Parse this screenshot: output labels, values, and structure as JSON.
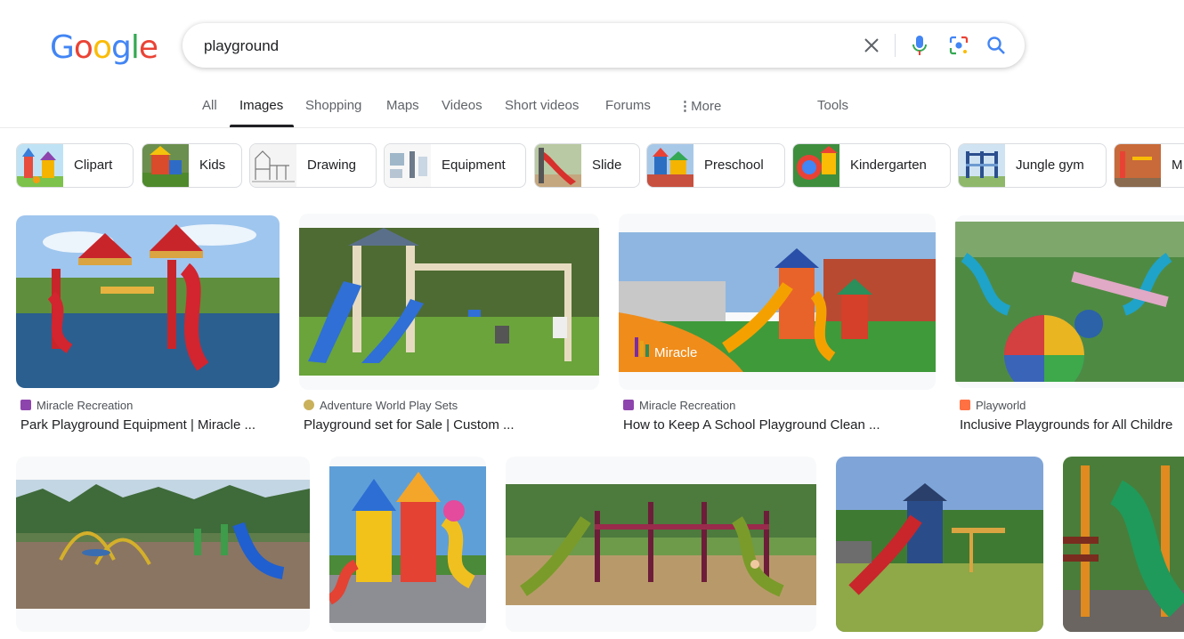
{
  "logo": {
    "letters": [
      "G",
      "o",
      "o",
      "g",
      "l",
      "e"
    ]
  },
  "search": {
    "query": "playground"
  },
  "tabs": [
    {
      "label": "All"
    },
    {
      "label": "Images"
    },
    {
      "label": "Shopping"
    },
    {
      "label": "Maps"
    },
    {
      "label": "Videos"
    },
    {
      "label": "Short videos"
    },
    {
      "label": "Forums"
    },
    {
      "label": "More"
    }
  ],
  "tools_label": "Tools",
  "chips": [
    {
      "label": "Clipart"
    },
    {
      "label": "Kids"
    },
    {
      "label": "Drawing"
    },
    {
      "label": "Equipment"
    },
    {
      "label": "Slide"
    },
    {
      "label": "Preschool"
    },
    {
      "label": "Kindergarten"
    },
    {
      "label": "Jungle gym"
    },
    {
      "label": "M"
    }
  ],
  "results_row1": [
    {
      "source": "Miracle Recreation",
      "title": "Park Playground Equipment | Miracle ..."
    },
    {
      "source": "Adventure World Play Sets",
      "title": "Playground set for Sale | Custom ..."
    },
    {
      "source": "Miracle Recreation",
      "title": "How to Keep A School Playground Clean ...",
      "overlay_text": "Miracle"
    },
    {
      "source": "Playworld",
      "title": "Inclusive Playgrounds for All Childre"
    }
  ],
  "colors": {
    "google_blue": "#4285f4",
    "google_red": "#ea4335",
    "google_yellow": "#fbbc05",
    "google_green": "#34a853"
  }
}
